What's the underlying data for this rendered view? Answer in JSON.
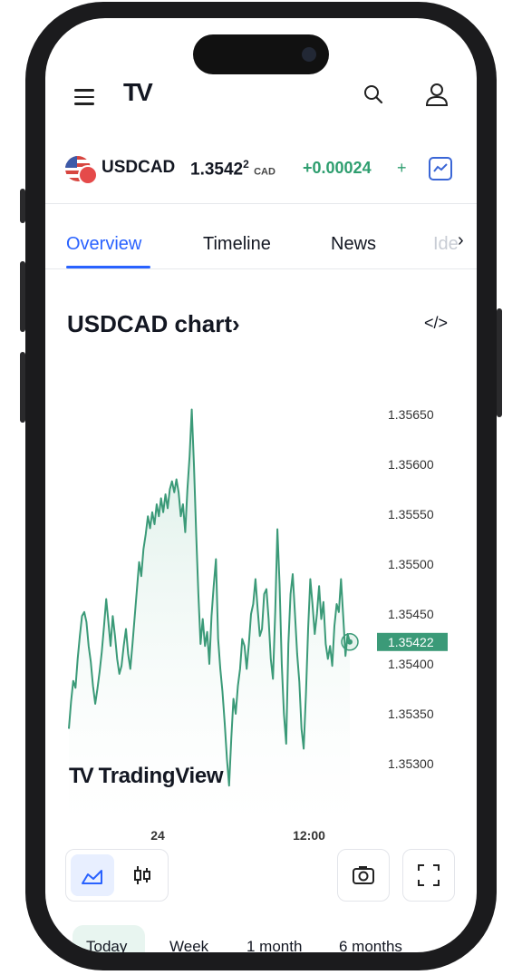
{
  "header": {
    "menu_icon": "hamburger-menu-icon",
    "logo_text": "TV",
    "search_icon": "search-icon",
    "user_icon": "user-icon"
  },
  "ticker": {
    "symbol": "USDCAD",
    "price_main": "1.3542",
    "price_sup": "2",
    "currency": "CAD",
    "change": "+0.00024",
    "change_suffix": "+",
    "accent_color": "#2e9e6f"
  },
  "tabs": [
    {
      "label": "Overview",
      "active": true
    },
    {
      "label": "Timeline"
    },
    {
      "label": "News"
    },
    {
      "label": "Ide"
    }
  ],
  "chart_section": {
    "title": "USDCAD chart",
    "chevron": "›",
    "embed_label": "</>",
    "brand_text": "TradingView"
  },
  "chart_data": {
    "type": "area",
    "x_tick_labels": [
      "24",
      "12:00"
    ],
    "y_tick_labels": [
      "1.35650",
      "1.35600",
      "1.35550",
      "1.35500",
      "1.35450",
      "1.35400",
      "1.35350",
      "1.35300"
    ],
    "last_price_label": "1.35422",
    "ylim": [
      1.3526,
      1.3568
    ],
    "series": [
      {
        "color": "#3b9a78",
        "values": [
          1.35335,
          1.35362,
          1.35383,
          1.35376,
          1.35405,
          1.35428,
          1.35448,
          1.35452,
          1.35442,
          1.35418,
          1.35402,
          1.35378,
          1.3536,
          1.35375,
          1.35392,
          1.35412,
          1.35438,
          1.35465,
          1.35442,
          1.35418,
          1.35448,
          1.35428,
          1.35405,
          1.3539,
          1.35398,
          1.35418,
          1.35435,
          1.3541,
          1.35395,
          1.3542,
          1.35448,
          1.35475,
          1.35502,
          1.35488,
          1.35515,
          1.3553,
          1.35548,
          1.35536,
          1.35552,
          1.3554,
          1.3556,
          1.35548,
          1.35566,
          1.35552,
          1.3557,
          1.35556,
          1.35575,
          1.35583,
          1.35572,
          1.35585,
          1.35572,
          1.35548,
          1.3556,
          1.35532,
          1.35575,
          1.35608,
          1.35655,
          1.356,
          1.3553,
          1.3547,
          1.3542,
          1.35445,
          1.35418,
          1.35432,
          1.354,
          1.35448,
          1.35478,
          1.35505,
          1.35425,
          1.35395,
          1.35372,
          1.3534,
          1.35305,
          1.35278,
          1.35325,
          1.35365,
          1.3535,
          1.35378,
          1.35395,
          1.35425,
          1.35418,
          1.35395,
          1.3542,
          1.3545,
          1.3546,
          1.35485,
          1.35455,
          1.35428,
          1.35435,
          1.3547,
          1.35475,
          1.35445,
          1.35405,
          1.35385,
          1.35452,
          1.35535,
          1.3548,
          1.354,
          1.3535,
          1.3532,
          1.3542,
          1.3547,
          1.3549,
          1.3545,
          1.3541,
          1.35382,
          1.35335,
          1.35315,
          1.3537,
          1.35435,
          1.35485,
          1.3546,
          1.3543,
          1.3545,
          1.35478,
          1.35445,
          1.35462,
          1.3542,
          1.35405,
          1.35418,
          1.35398,
          1.35438,
          1.3546,
          1.35452,
          1.35485,
          1.35448,
          1.35408,
          1.3543,
          1.35422
        ]
      }
    ]
  },
  "controls": {
    "line_chart_icon": "line-chart-icon",
    "candle_icon": "candlestick-icon",
    "camera_icon": "camera-icon",
    "fullscreen_icon": "fullscreen-icon"
  },
  "periods": [
    {
      "label": "Today",
      "active": true
    },
    {
      "label": "Week"
    },
    {
      "label": "1 month"
    },
    {
      "label": "6 months"
    }
  ]
}
